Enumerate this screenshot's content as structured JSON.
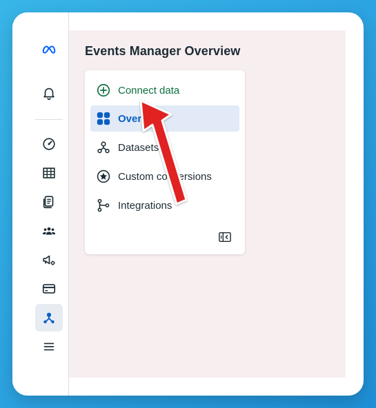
{
  "page": {
    "title": "Events Manager Overview"
  },
  "rail": {
    "items": [
      {
        "name": "meta-logo-icon"
      },
      {
        "name": "notifications-bell-icon"
      },
      {
        "name": "dashboard-gauge-icon"
      },
      {
        "name": "table-icon"
      },
      {
        "name": "documents-icon"
      },
      {
        "name": "audience-people-icon"
      },
      {
        "name": "campaign-megaphone-gear-icon"
      },
      {
        "name": "billing-card-icon"
      },
      {
        "name": "events-manager-network-icon",
        "active": true
      },
      {
        "name": "menu-hamburger-icon"
      }
    ]
  },
  "menu": {
    "items": [
      {
        "label": "Connect data",
        "icon": "plus-circle-icon",
        "color": "#0d6e3f"
      },
      {
        "label": "Overview",
        "icon": "overview-tiles-icon",
        "selected": true,
        "color": "#0a5fc4"
      },
      {
        "label": "Datasets",
        "icon": "datasets-network-icon"
      },
      {
        "label": "Custom conversions",
        "icon": "star-circle-icon"
      },
      {
        "label": "Integrations",
        "icon": "integrations-nodes-icon"
      }
    ],
    "collapse_icon": "collapse-sidebar-icon"
  },
  "annotation": {
    "icon": "red-arrow-icon",
    "color": "#e02424"
  }
}
